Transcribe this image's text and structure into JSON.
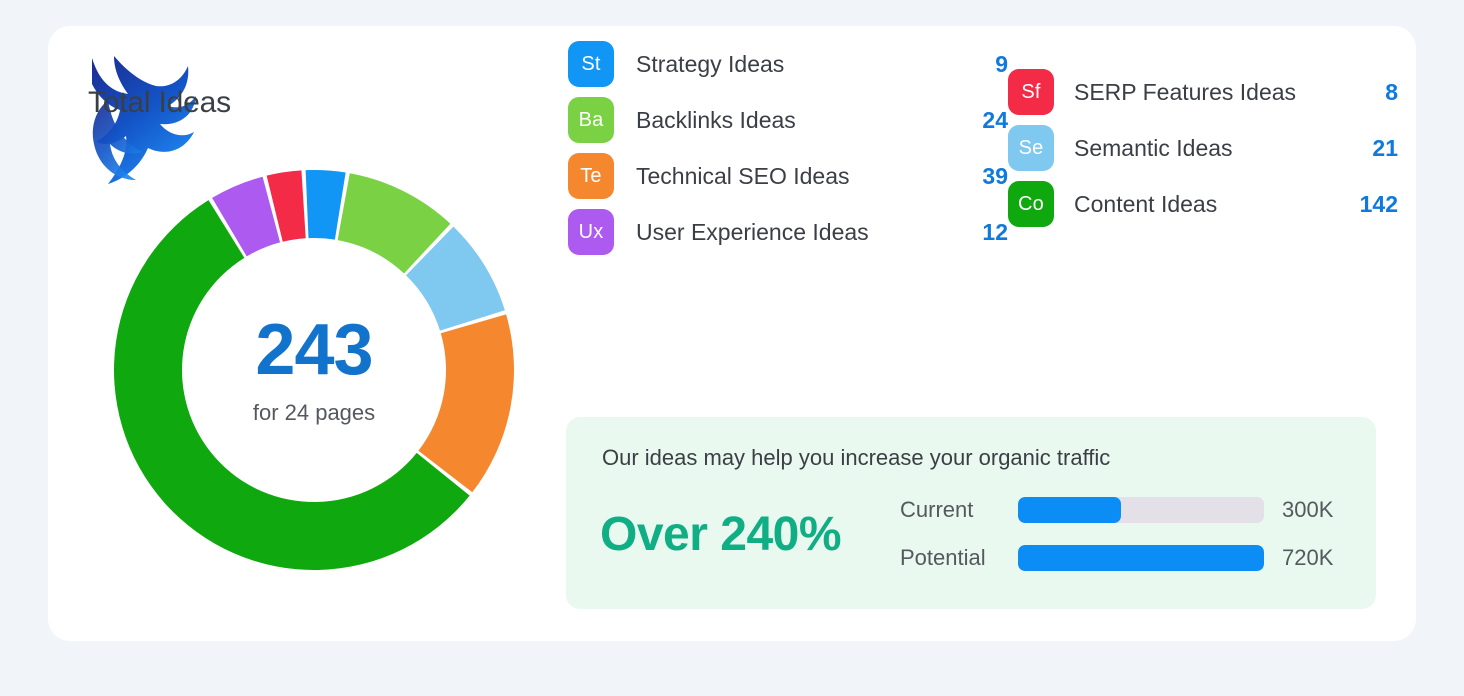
{
  "page": {
    "background_color": "#f1f4f8",
    "card_background": "#ffffff",
    "title": "Total Ideas",
    "logo_name": "bull-logo-watermark"
  },
  "donut": {
    "total": "243",
    "subtitle": "for 24 pages"
  },
  "legend": {
    "column_a": [
      {
        "code": "St",
        "label": "Strategy Ideas",
        "value": "9",
        "color": "#1296f5"
      },
      {
        "code": "Ba",
        "label": "Backlinks Ideas",
        "value": "24",
        "color": "#7bd144"
      },
      {
        "code": "Te",
        "label": "Technical SEO Ideas",
        "value": "39",
        "color": "#f5882e"
      },
      {
        "code": "Ux",
        "label": "User Experience Ideas",
        "value": "12",
        "color": "#ac5af0"
      }
    ],
    "column_b": [
      {
        "code": "Sf",
        "label": "SERP Features Ideas",
        "value": "8",
        "color": "#f42b47"
      },
      {
        "code": "Se",
        "label": "Semantic Ideas",
        "value": "21",
        "color": "#7fc8f0"
      },
      {
        "code": "Co",
        "label": "Content Ideas",
        "value": "142",
        "color": "#0fa80f"
      }
    ]
  },
  "traffic": {
    "headline": "Our ideas may help you increase your organic traffic",
    "increase": "Over 240%",
    "increase_color": "#0fae85",
    "panel_color": "#e9f9ef",
    "bars": [
      {
        "label": "Current",
        "value": "300K",
        "percent": 41.7,
        "fill_color": "#0c8df5",
        "track_color": "#e3e0e8"
      },
      {
        "label": "Potential",
        "value": "720K",
        "percent": 100,
        "fill_color": "#0c8df5",
        "track_color": "#e3e0e8"
      }
    ]
  },
  "chart_data": {
    "type": "pie",
    "title": "Total Ideas",
    "center_label": "243",
    "center_sublabel": "for 24 pages",
    "total": 243,
    "unit": "ideas",
    "categories": [
      "Strategy Ideas",
      "Backlinks Ideas",
      "Semantic Ideas",
      "Technical SEO Ideas",
      "Content Ideas",
      "User Experience Ideas",
      "SERP Features Ideas"
    ],
    "values": [
      9,
      24,
      21,
      39,
      142,
      12,
      8
    ],
    "colors": [
      "#1296f5",
      "#7bd144",
      "#7fc8f0",
      "#f5882e",
      "#0fa80f",
      "#ac5af0",
      "#f42b47"
    ],
    "codes": [
      "St",
      "Ba",
      "Se",
      "Te",
      "Co",
      "Ux",
      "Sf"
    ],
    "donut_inner_ratio": 0.66,
    "start_angle_deg": -3,
    "legend_position": "right",
    "grid": false
  }
}
